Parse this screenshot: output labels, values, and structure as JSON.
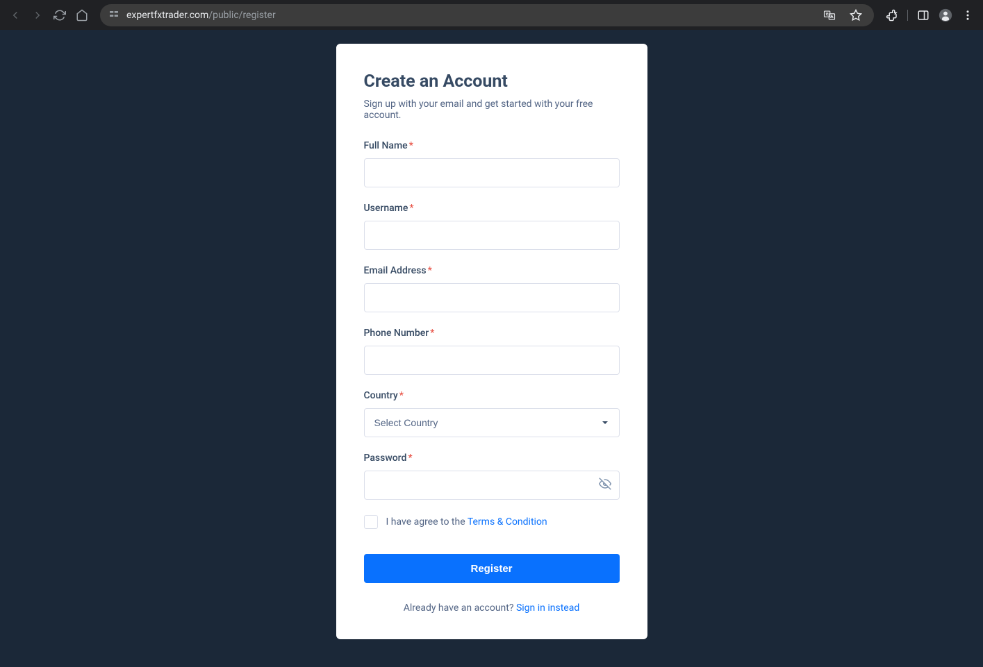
{
  "browser": {
    "url_domain": "expertfxtrader.com",
    "url_path": "/public/register"
  },
  "form": {
    "title": "Create an Account",
    "subtitle": "Sign up with your email and get started with your free account.",
    "fields": {
      "fullname": {
        "label": "Full Name"
      },
      "username": {
        "label": "Username"
      },
      "email": {
        "label": "Email Address"
      },
      "phone": {
        "label": "Phone Number"
      },
      "country": {
        "label": "Country",
        "placeholder": "Select Country"
      },
      "password": {
        "label": "Password"
      }
    },
    "checkbox_prefix": "I have agree to the ",
    "checkbox_link": "Terms & Condition",
    "submit_label": "Register",
    "footer_prefix": "Already have an account? ",
    "footer_link": "Sign in instead"
  }
}
